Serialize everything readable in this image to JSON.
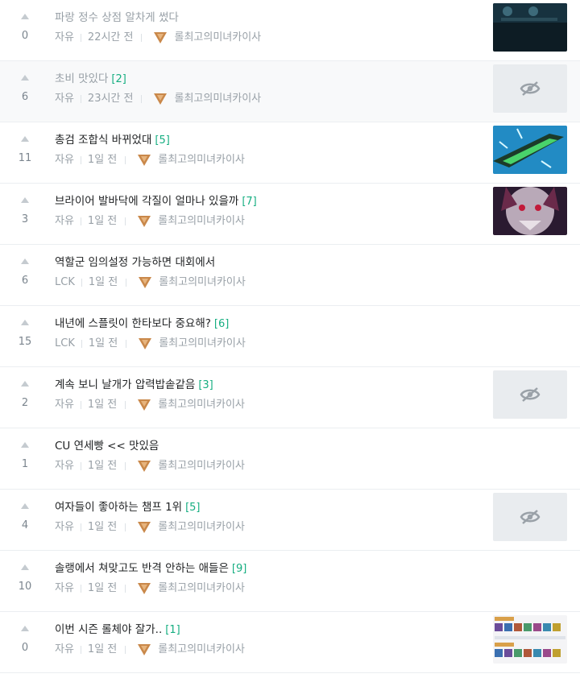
{
  "posts": [
    {
      "votes": "0",
      "title": "파랑 정수 상점 알차게 썼다",
      "comments": "",
      "category": "자유",
      "time": "22시간 전",
      "author": "롤최고의미녀카이사",
      "thumb": "dark",
      "read": true
    },
    {
      "votes": "6",
      "title": "초비 맛있다",
      "comments": "[2]",
      "category": "자유",
      "time": "23시간 전",
      "author": "롤최고의미녀카이사",
      "thumb": "hidden",
      "read": true
    },
    {
      "votes": "11",
      "title": "총검 조합식 바뀌었대",
      "comments": "[5]",
      "category": "자유",
      "time": "1일 전",
      "author": "롤최고의미녀카이사",
      "thumb": "sword",
      "read": false
    },
    {
      "votes": "3",
      "title": "브라이어 발바닥에 각질이 얼마나 있을까",
      "comments": "[7]",
      "category": "자유",
      "time": "1일 전",
      "author": "롤최고의미녀카이사",
      "thumb": "briar",
      "read": false
    },
    {
      "votes": "6",
      "title": "역할군 임의설정 가능하면 대회에서",
      "comments": "",
      "category": "LCK",
      "time": "1일 전",
      "author": "롤최고의미녀카이사",
      "thumb": "none",
      "read": false
    },
    {
      "votes": "15",
      "title": "내년에 스플릿이 한타보다 중요해?",
      "comments": "[6]",
      "category": "LCK",
      "time": "1일 전",
      "author": "롤최고의미녀카이사",
      "thumb": "none",
      "read": false
    },
    {
      "votes": "2",
      "title": "계속 보니 날개가 압력밥솥같음",
      "comments": "[3]",
      "category": "자유",
      "time": "1일 전",
      "author": "롤최고의미녀카이사",
      "thumb": "hidden",
      "read": false
    },
    {
      "votes": "1",
      "title": "CU 연세빵 << 맛있음",
      "comments": "",
      "category": "자유",
      "time": "1일 전",
      "author": "롤최고의미녀카이사",
      "thumb": "none",
      "read": false
    },
    {
      "votes": "4",
      "title": "여자들이 좋아하는 챔프 1위",
      "comments": "[5]",
      "category": "자유",
      "time": "1일 전",
      "author": "롤최고의미녀카이사",
      "thumb": "hidden",
      "read": false
    },
    {
      "votes": "10",
      "title": "솔랭에서 쳐맞고도 반격 안하는 애들은",
      "comments": "[9]",
      "category": "자유",
      "time": "1일 전",
      "author": "롤최고의미녀카이사",
      "thumb": "none",
      "read": false
    },
    {
      "votes": "0",
      "title": "이번 시즌 롤체야 잘가..",
      "comments": "[1]",
      "category": "자유",
      "time": "1일 전",
      "author": "롤최고의미녀카이사",
      "thumb": "grid",
      "read": false
    }
  ],
  "icons": {
    "vote": "upvote-arrow-icon",
    "rank": "rank-emblem-icon",
    "hidden": "hidden-eye-icon"
  },
  "colors": {
    "comment": "#16ae81",
    "meta": "#98a0a7",
    "rank": "#c9884a"
  }
}
